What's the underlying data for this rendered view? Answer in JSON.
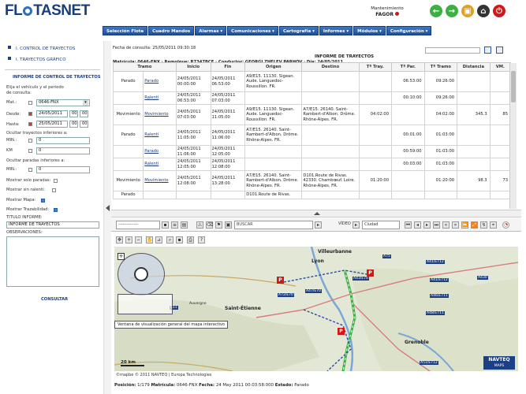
{
  "header": {
    "logo": "FL TASNET",
    "user_role": "Mantenimiento",
    "user_name": "FAGOR",
    "icons": [
      {
        "name": "back-icon",
        "glyph": "←",
        "color": "#3cb043"
      },
      {
        "name": "forward-icon",
        "glyph": "→",
        "color": "#3cb043"
      },
      {
        "name": "users-icon",
        "glyph": "▣",
        "color": "#e0a020"
      },
      {
        "name": "home-icon",
        "glyph": "⌂",
        "color": "#333333"
      },
      {
        "name": "power-icon",
        "glyph": "⏻",
        "color": "#d01818"
      }
    ]
  },
  "nav": [
    "Selección Flota",
    "Cuadro Mandos",
    "Alarmas ▾",
    "Comunicaciones ▾",
    "Cartografía ▾",
    "Informes ▾",
    "Módulos ▾",
    "Configuración ▾"
  ],
  "sidebar": {
    "items": [
      "I. CONTROL DE TRAYECTOS",
      "I. TRAYECTOS GRÁFICO"
    ],
    "form_title": "INFORME DE CONTROL DE TRAYECTOS",
    "intro": "Elija el vehículo y el periodo",
    "intro2": "de consulta:",
    "mat_label": "Mat.:",
    "mat_value": "0646-FNX",
    "desde_label": "Desde:",
    "desde_date": "24/05/2011",
    "desde_h": "00",
    "desde_m": "00",
    "hasta_label": "Hasta:",
    "hasta_date": "25/05/2011",
    "hasta_h": "00",
    "hasta_m": "00",
    "ocultar_tray": "Ocultar trayectos inferiores a:",
    "min_label": "MIN.:",
    "min_value": "0",
    "km_label": "KM",
    "km_value": "0",
    "ocultar_par": "Ocultar paradas inferiores a:",
    "min2_label": "MIN.:",
    "min2_value": "0",
    "solo_paradas": "Mostrar solo paradas:",
    "sin_ralenti": "Mostrar sin ralentí:",
    "mostrar_mapa": "Mostrar Mapa:",
    "mostrar_traz": "Mostrar Trazabilidad:",
    "titulo_label": "TITULO INFORME:",
    "titulo_value": "INFORME DE TRAYECTOS",
    "obs_label": "OBSERVACIONES:",
    "consultar": "CONSULTAR"
  },
  "report": {
    "fecha": "Fecha de consulta: 25/05/2011 09:30:18",
    "title": "INFORME DE TRAYECTOS",
    "meta": "Matrícula: 0646-FNX · Remolque: R7347BCF · Conductor: GEORGI ZHELEV PARHOV · Día: 24/05/2011",
    "columns": [
      "Tramo",
      "",
      "Inicio",
      "Fin",
      "Origen",
      "Destino",
      "Tª Tray.",
      "Tª Par.",
      "Tª Tramo",
      "Distancia",
      "VM."
    ],
    "rows": [
      {
        "tramo": "Parado",
        "tipo": "Parado",
        "inicio": "24/05/2011 00:00:00",
        "fin": "24/05/2011 06:53:00",
        "origen": "A9/E15. 11130. Sigean. Aude. Languedoc-Roussillon. FR.",
        "destino": "",
        "tray": "",
        "par": "06:53:00",
        "tr": "09:26:00",
        "dist": "",
        "vm": ""
      },
      {
        "tramo": "",
        "tipo": "Ralentí",
        "inicio": "24/05/2011 06:53:00",
        "fin": "24/05/2011 07:03:00",
        "origen": "",
        "destino": "",
        "tray": "",
        "par": "00:10:00",
        "tr": "09:26:00",
        "dist": "",
        "vm": ""
      },
      {
        "tramo": "Movimiento",
        "tipo": "Movimiento",
        "inicio": "24/05/2011 07:03:00",
        "fin": "24/05/2011 11:05:00",
        "origen": "A9/E15. 11130. Sigean. Aude. Languedoc-Roussillon. FR.",
        "destino": "A7/E15. 26140. Saint-Rambert-d'Albon. Drôme. Rhône-Alpes. FR.",
        "tray": "04:02:00",
        "par": "",
        "tr": "04:02:00",
        "dist": "345.3",
        "vm": "85"
      },
      {
        "tramo": "Parado",
        "tipo": "Ralentí",
        "inicio": "24/05/2011 11:05:00",
        "fin": "24/05/2011 11:06:00",
        "origen": "A7/E15. 26140. Saint-Rambert-d'Albon. Drôme. Rhône-Alpes. FR.",
        "destino": "",
        "tray": "",
        "par": "00:01:00",
        "tr": "01:03:00",
        "dist": "",
        "vm": ""
      },
      {
        "tramo": "",
        "tipo": "Parado",
        "inicio": "24/05/2011 11:06:00",
        "fin": "24/05/2011 12:05:00",
        "origen": "",
        "destino": "",
        "tray": "",
        "par": "00:59:00",
        "tr": "01:03:00",
        "dist": "",
        "vm": ""
      },
      {
        "tramo": "",
        "tipo": "Ralentí",
        "inicio": "24/05/2011 12:05:00",
        "fin": "24/05/2011 12:08:00",
        "origen": "",
        "destino": "",
        "tray": "",
        "par": "00:03:00",
        "tr": "01:03:00",
        "dist": "",
        "vm": ""
      },
      {
        "tramo": "Movimiento",
        "tipo": "Movimiento",
        "inicio": "24/05/2011 12:08:00",
        "fin": "24/05/2011 13:28:00",
        "origen": "A7/E15. 26140. Saint-Rambert-d'Albon. Drôme. Rhône-Alpes. FR.",
        "destino": "D101.Route de Rivas. 42330. Chambœuf. Loire. Rhône-Alpes. FR.",
        "tray": "01:20:00",
        "par": "",
        "tr": "01:20:00",
        "dist": "98.3",
        "vm": "73"
      },
      {
        "tramo": "Parado",
        "tipo": "",
        "inicio": "",
        "fin": "",
        "origen": "D101.Route de Rivas.",
        "destino": "",
        "tray": "",
        "par": "",
        "tr": "",
        "dist": "",
        "vm": ""
      }
    ]
  },
  "maptool": {
    "select": "--------------",
    "buscar": "BUSCAR",
    "video": "VÍDEO",
    "ciudad": "Ciudad"
  },
  "map": {
    "labels": [
      "Villeurbanne",
      "Lyon",
      "Saint-Étienne",
      "Auvergne",
      "Grenoble",
      "A41/E712",
      "A43/E70",
      "A46/E711",
      "A48/E711",
      "A41/E712",
      "A51/E712",
      "A430",
      "A72/E70",
      "A47/E70",
      "A75",
      "E11"
    ],
    "tooltip": "Ventana de visualización general del mapa interactivo",
    "scale": "20 km",
    "brand": "NAVTEQ",
    "brand2": "MAPS"
  },
  "footer": {
    "copyright": "©mapbe © 2011 NAVTEQ | Europa Technologies"
  },
  "status": {
    "pos_label": "Posición:",
    "pos": "1/179",
    "mat_label": "Matrícula:",
    "mat": "0646-FNX",
    "fecha_label": "Fecha:",
    "fecha": "24 May 2011 00:03:58:000",
    "estado_label": "Estado:",
    "estado": "Parado"
  }
}
